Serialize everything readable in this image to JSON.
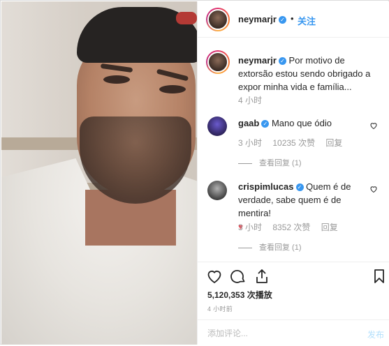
{
  "header": {
    "username": "neymarjr",
    "follow_label": "关注"
  },
  "caption": {
    "username": "neymarjr",
    "text": "Por motivo de extorsão estou sendo obrigado a expor minha vida e família...",
    "time": "4 小时"
  },
  "comments": [
    {
      "username": "gaab",
      "text": "Mano que ódio",
      "time": "3 小时",
      "likes": "10235 次赞",
      "reply_label": "回复",
      "view_replies": "查看回复 (1)"
    },
    {
      "username": "crispimlucas",
      "text": "Quem é de verdade, sabe quem é de mentira!",
      "emoji": "♥",
      "time": "3 小时",
      "likes": "8352 次赞",
      "reply_label": "回复",
      "view_replies": "查看回复 (1)"
    }
  ],
  "stats": {
    "views": "5,120,353 次播放",
    "time_ago": "4 小时前"
  },
  "add_comment": {
    "placeholder": "添加评论...",
    "post_label": "发布"
  },
  "colors": {
    "accent": "#3897f0",
    "heart": "#ed4956",
    "muted": "#999999"
  }
}
